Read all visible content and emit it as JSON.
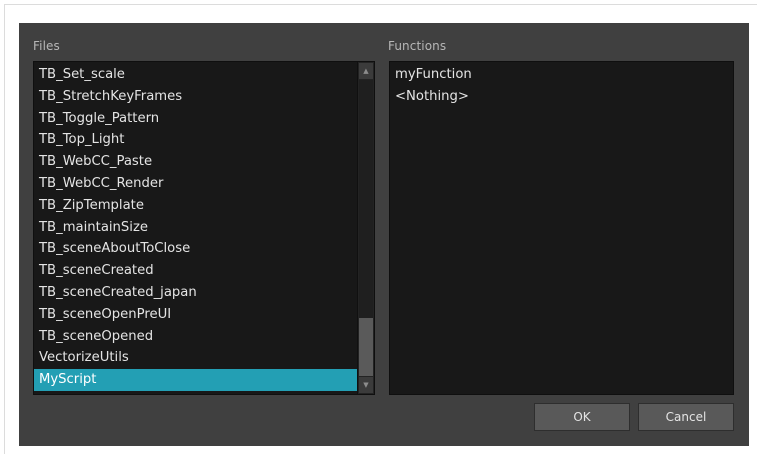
{
  "files": {
    "label": "Files",
    "items": [
      "TB_Set_scale",
      "TB_StretchKeyFrames",
      "TB_Toggle_Pattern",
      "TB_Top_Light",
      "TB_WebCC_Paste",
      "TB_WebCC_Render",
      "TB_ZipTemplate",
      "TB_maintainSize",
      "TB_sceneAboutToClose",
      "TB_sceneCreated",
      "TB_sceneCreated_japan",
      "TB_sceneOpenPreUI",
      "TB_sceneOpened",
      "VectorizeUtils",
      "MyScript"
    ],
    "selected_index": 14,
    "scroll_position": 1.0,
    "selected_color": "#239fb4"
  },
  "functions": {
    "label": "Functions",
    "items": [
      "myFunction",
      "<Nothing>"
    ]
  },
  "buttons": {
    "ok_label": "OK",
    "cancel_label": "Cancel"
  },
  "icons": {
    "scroll_up": "chevron-up-icon",
    "scroll_down": "chevron-down-icon"
  }
}
